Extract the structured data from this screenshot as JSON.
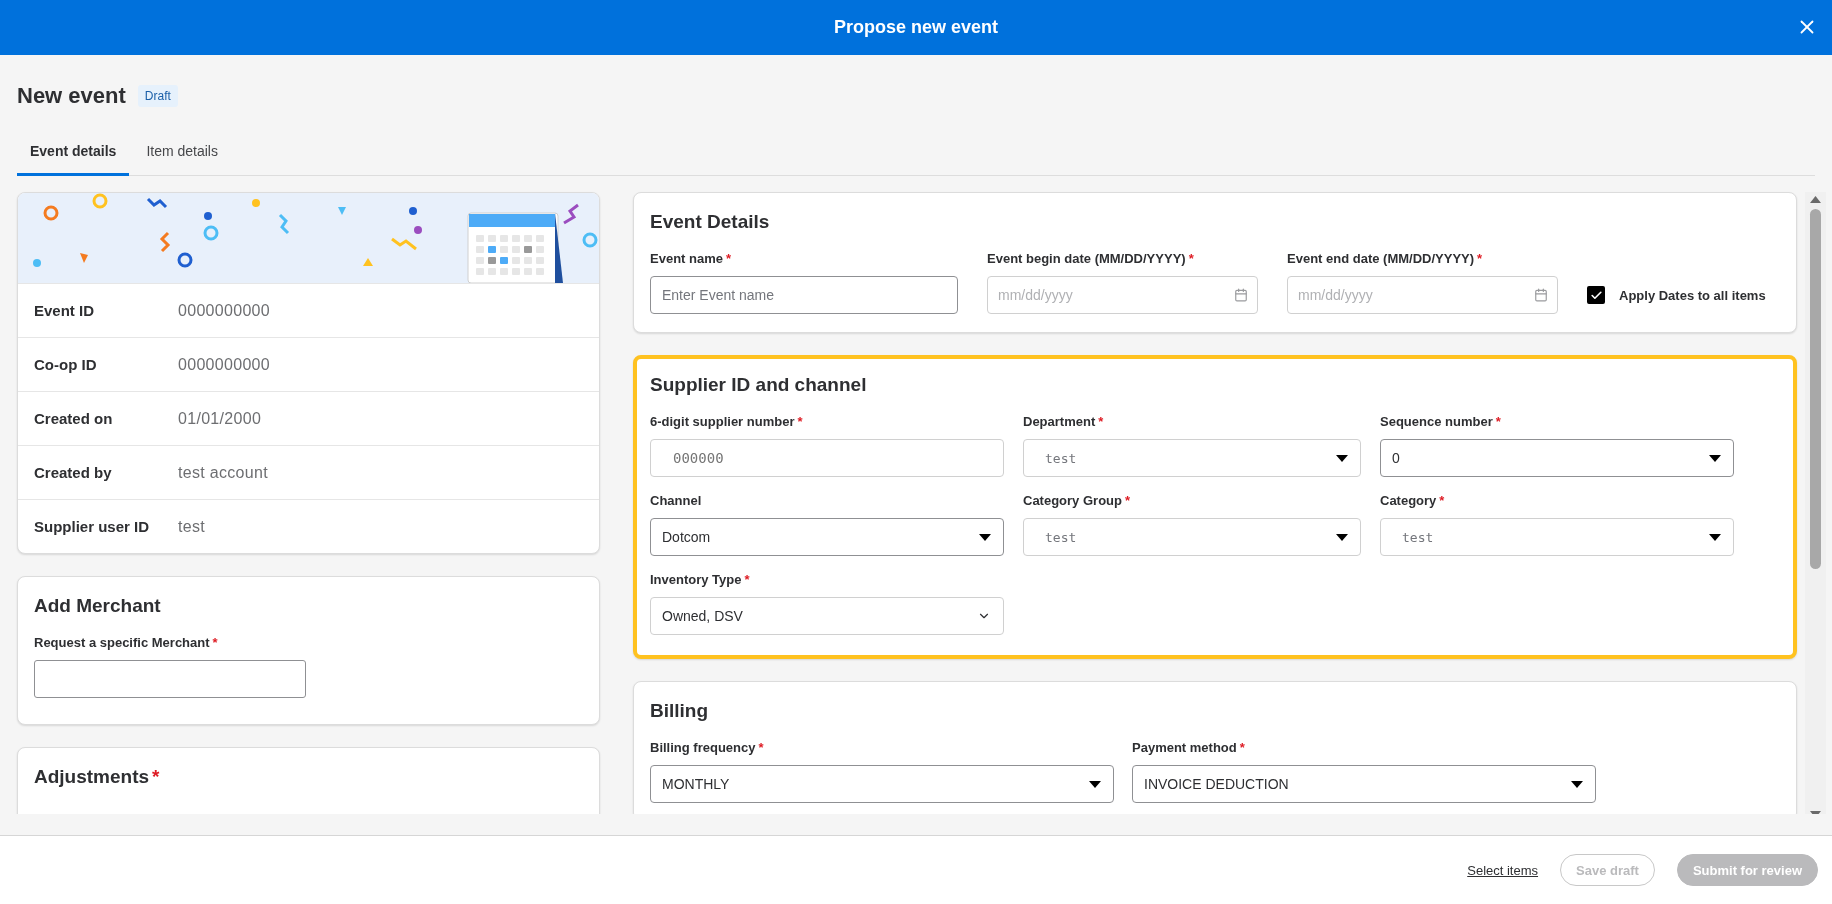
{
  "header": {
    "title": "Propose new event"
  },
  "page": {
    "title": "New event",
    "badge": "Draft"
  },
  "tabs": [
    {
      "label": "Event details",
      "selected": true
    },
    {
      "label": "Item details",
      "selected": false
    }
  ],
  "summary": {
    "rows": [
      {
        "label": "Event ID",
        "value": "0000000000"
      },
      {
        "label": "Co-op ID",
        "value": "0000000000"
      },
      {
        "label": "Created on",
        "value": "01/01/2000"
      },
      {
        "label": "Created by",
        "value": "test account"
      },
      {
        "label": "Supplier user ID",
        "value": "test"
      }
    ]
  },
  "merchant": {
    "title": "Add Merchant",
    "field": {
      "label": "Request a specific Merchant",
      "mark": "*"
    }
  },
  "adjustments": {
    "title": "Adjustments",
    "mark": "*"
  },
  "event_details": {
    "title": "Event Details",
    "fields": [
      {
        "kind": "text",
        "label": "Event name",
        "mark": "*",
        "placeholder": "Enter Event name"
      },
      {
        "kind": "date",
        "label": "Event begin date (MM/DD/YYYY)",
        "mark": "*",
        "placeholder": "mm/dd/yyyy"
      },
      {
        "kind": "date",
        "label": "Event end date (MM/DD/YYYY)",
        "mark": "*",
        "placeholder": "mm/dd/yyyy"
      }
    ],
    "apply_dates": {
      "label": "Apply Dates to all items",
      "checked": true
    }
  },
  "supplier": {
    "title": "Supplier ID and channel",
    "highlighted": true,
    "fields": [
      {
        "kind": "text",
        "label": "6-digit supplier number",
        "mark": "*",
        "placeholder": "000000"
      },
      {
        "kind": "select",
        "label": "Department",
        "mark": "*",
        "placeholder": "test"
      },
      {
        "kind": "select",
        "label": "Sequence number",
        "mark": "*",
        "value": "0"
      },
      {
        "kind": "select",
        "label": "Channel",
        "value": "Dotcom"
      },
      {
        "kind": "select",
        "label": "Category Group",
        "mark": "*",
        "placeholder": "test"
      },
      {
        "kind": "select",
        "label": "Category",
        "mark": "*",
        "placeholder": "test"
      },
      {
        "kind": "native",
        "label": "Inventory Type",
        "mark": "*",
        "value": "Owned, DSV"
      }
    ]
  },
  "billing": {
    "title": "Billing",
    "fields": [
      {
        "kind": "select",
        "label": "Billing frequency",
        "mark": "*",
        "value": "MONTHLY"
      },
      {
        "kind": "select",
        "label": "Payment method",
        "mark": "*",
        "value": "INVOICE DEDUCTION"
      }
    ]
  },
  "footer": {
    "link": "Select items",
    "buttons": [
      {
        "label": "Save draft",
        "kind": "outline",
        "disabled": true
      },
      {
        "label": "Submit for review",
        "kind": "primary",
        "disabled": true
      }
    ]
  }
}
